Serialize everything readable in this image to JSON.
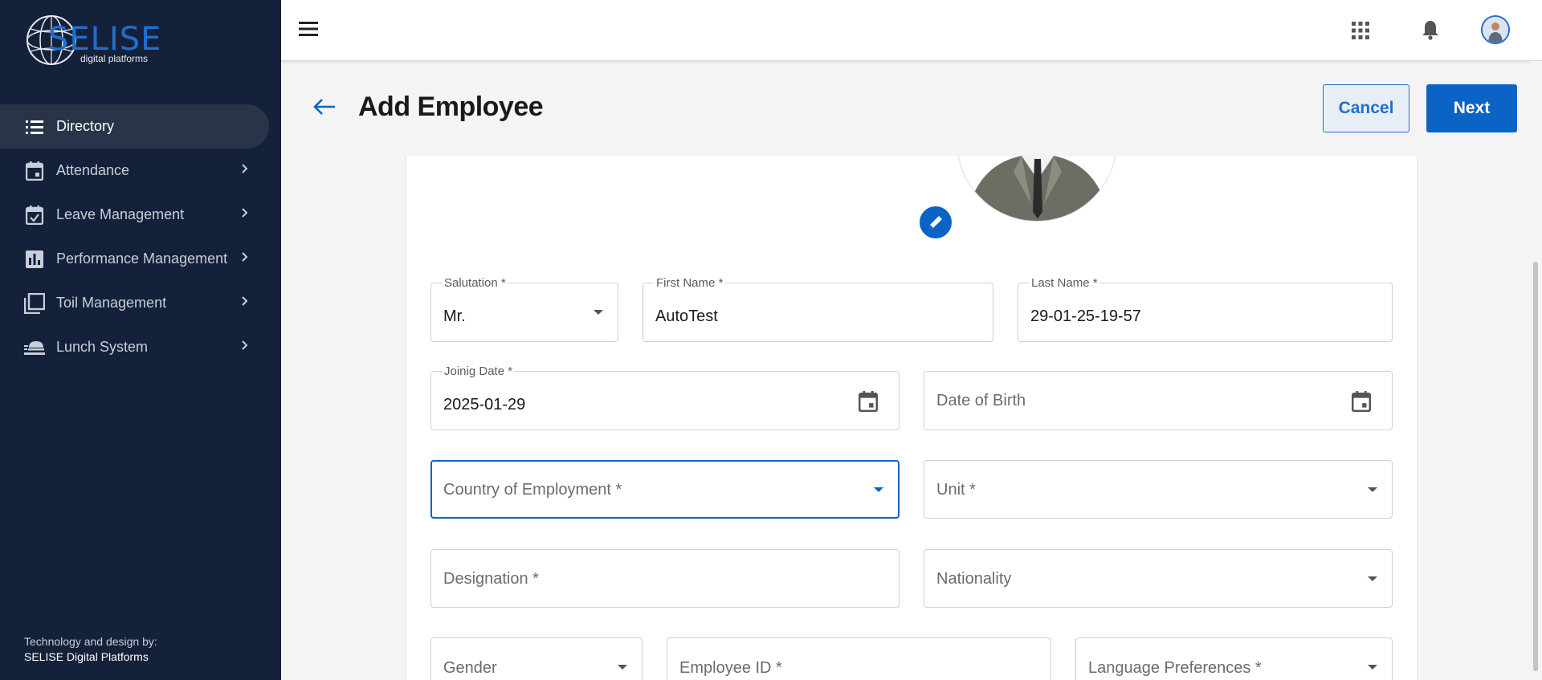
{
  "brand": {
    "name": "SELISE",
    "tagline": "digital platforms"
  },
  "sidebar": {
    "items": [
      {
        "label": "Directory",
        "icon": "list-icon",
        "active": true
      },
      {
        "label": "Attendance",
        "icon": "calendar-icon"
      },
      {
        "label": "Leave Management",
        "icon": "calendar-check-icon"
      },
      {
        "label": "Performance Management",
        "icon": "bar-chart-icon"
      },
      {
        "label": "Toil Management",
        "icon": "copy-icon"
      },
      {
        "label": "Lunch System",
        "icon": "food-icon"
      }
    ],
    "credit_line": "Technology and design by:",
    "credit_company": "SELISE Digital Platforms"
  },
  "topbar": {
    "icons": [
      "menu-icon",
      "apps-grid-icon",
      "bell-icon",
      "user-avatar"
    ]
  },
  "header": {
    "title": "Add Employee",
    "cancel_label": "Cancel",
    "next_label": "Next"
  },
  "form": {
    "salutation": {
      "label": "Salutation *",
      "value": "Mr."
    },
    "first_name": {
      "label": "First Name *",
      "value": "AutoTest"
    },
    "last_name": {
      "label": "Last Name *",
      "value": "29-01-25-19-57"
    },
    "joining_date": {
      "label": "Joinig Date *",
      "value": "2025-01-29"
    },
    "date_of_birth": {
      "placeholder": "Date of Birth"
    },
    "country_of_employment": {
      "placeholder": "Country of Employment *"
    },
    "unit": {
      "placeholder": "Unit *"
    },
    "designation": {
      "placeholder": "Designation *"
    },
    "nationality": {
      "placeholder": "Nationality"
    },
    "gender": {
      "placeholder": "Gender"
    },
    "employee_id": {
      "placeholder": "Employee ID *"
    },
    "language_preferences": {
      "placeholder": "Language Preferences *"
    }
  },
  "colors": {
    "sidebar_bg": "#14213a",
    "primary": "#0b63c5",
    "page_bg": "#f4f4f4"
  }
}
